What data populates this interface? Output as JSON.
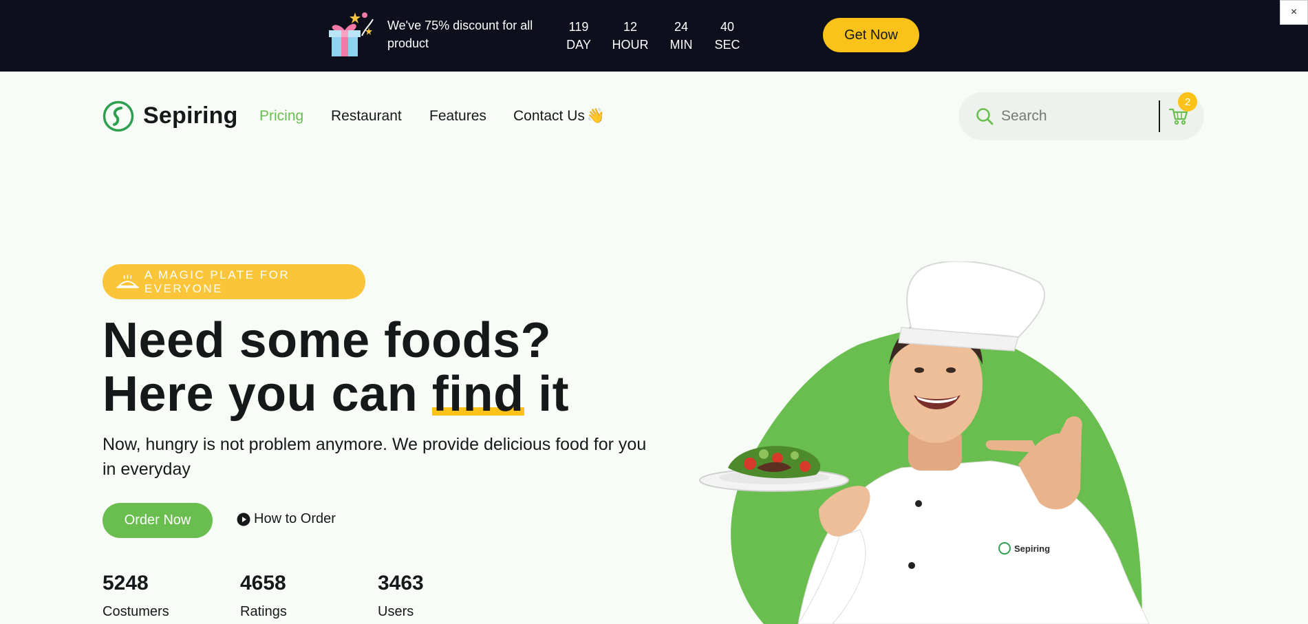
{
  "promo": {
    "text": "We've 75% discount for all product",
    "countdown": [
      {
        "value": "119",
        "unit": "DAY"
      },
      {
        "value": "12",
        "unit": "HOUR"
      },
      {
        "value": "24",
        "unit": "MIN"
      },
      {
        "value": "40",
        "unit": "SEC"
      }
    ],
    "cta_label": "Get Now",
    "close_label": "×"
  },
  "header": {
    "brand": "Sepiring",
    "nav": [
      {
        "label": "Pricing",
        "active": true
      },
      {
        "label": "Restaurant",
        "active": false
      },
      {
        "label": "Features",
        "active": false
      },
      {
        "label": "Contact Us",
        "active": false,
        "emoji": "👋"
      }
    ],
    "search_placeholder": "Search",
    "cart_count": "2"
  },
  "hero": {
    "tag": "A MAGIC PLATE FOR EVERYONE",
    "headline_line1": "Need some foods?",
    "headline_line2_pre": "Here you can ",
    "headline_line2_mark": "find",
    "headline_line2_post": " it",
    "subtext": "Now, hungry is not problem anymore. We provide delicious food for you in everyday",
    "primary_cta": "Order Now",
    "secondary_cta": "How to Order",
    "stats": [
      {
        "value": "5248",
        "label": "Costumers"
      },
      {
        "value": "4658",
        "label": "Ratings"
      },
      {
        "value": "3463",
        "label": "Users"
      }
    ],
    "jacket_brand": "Sepiring"
  },
  "colors": {
    "accent_green": "#6abd4f",
    "accent_yellow": "#fbc21a",
    "promo_bg": "#0e0f1c",
    "page_bg": "#f7fcf6"
  }
}
